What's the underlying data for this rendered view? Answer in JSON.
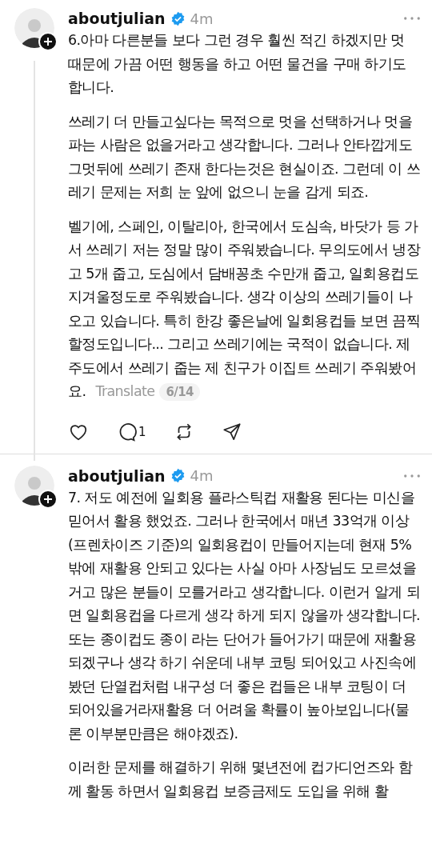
{
  "posts": [
    {
      "username": "aboutjulian",
      "verified": true,
      "time": "4m",
      "paragraphs": [
        "6.아마 다른분들 보다 그런 경우 훨씬 적긴 하겠지만 멋 때문에 가끔 어떤 행동을 하고 어떤 물건을 구매 하기도 합니다.",
        "쓰레기 더 만들고싶다는 목적으로 멋을 선택하거나 멋을 파는 사람은 없을거라고 생각합니다. 그러나 안타깝게도 그멋뒤에 쓰레기 존재 한다는것은 현실이죠. 그런데 이 쓰레기 문제는 저희 눈 앞에 없으니 눈을 감게 되죠.",
        "벨기에, 스페인, 이탈리아, 한국에서 도심속, 바닷가 등 가서 쓰레기 저는 정말 많이 주워봤습니다. 무의도에서 냉장고 5개 줍고, 도심에서 담배꽁초 수만개 줍고, 일회용컵도 지겨울정도로 주워봤습니다. 생각 이상의 쓰레기들이 나오고 있습니다. 특히 한강 좋은날에 일회용컵들 보면 끔찍할정도입니다... 그리고 쓰레기에는 국적이 없습니다. 제주도에서 쓰레기 줍는 제 친구가 이집트 쓰레기 주워봤어요."
      ],
      "translate": "Translate",
      "counter": "6/14",
      "replies": "1"
    },
    {
      "username": "aboutjulian",
      "verified": true,
      "time": "4m",
      "paragraphs": [
        "7. 저도 예전에 일회용 플라스틱컵 재활용 된다는 미신을 믿어서 활용 했었죠. 그러나 한국에서 매년 33억개 이상(프렌차이즈 기준)의 일회용컵이 만들어지는데 현재 5% 밖에 재활용 안되고 있다는 사실 아마 사장님도 모르셨을거고 많은 분들이 모를거라고 생각합니다. 이런거 알게 되면 일회용컵을 다르게 생각 하게 되지 않을까 생각합니다. 또는 종이컵도 종이 라는 단어가 들어가기 때문에 재활용 되겠구나 생각 하기 쉬운데 내부 코팅 되어있고 사진속에 봤던 단열컵처럼 내구성 더 좋은 컵들은 내부 코팅이 더 되어있을거라재활용 더 어려울 확률이 높아보입니다(물론 이부분만큼은 해야겠죠).",
        "이러한 문제를 해결하기 위해 몇년전에 컵가디언즈와 함께 활동 하면서 일회용컵 보증금제도 도입을 위해 활"
      ]
    }
  ]
}
